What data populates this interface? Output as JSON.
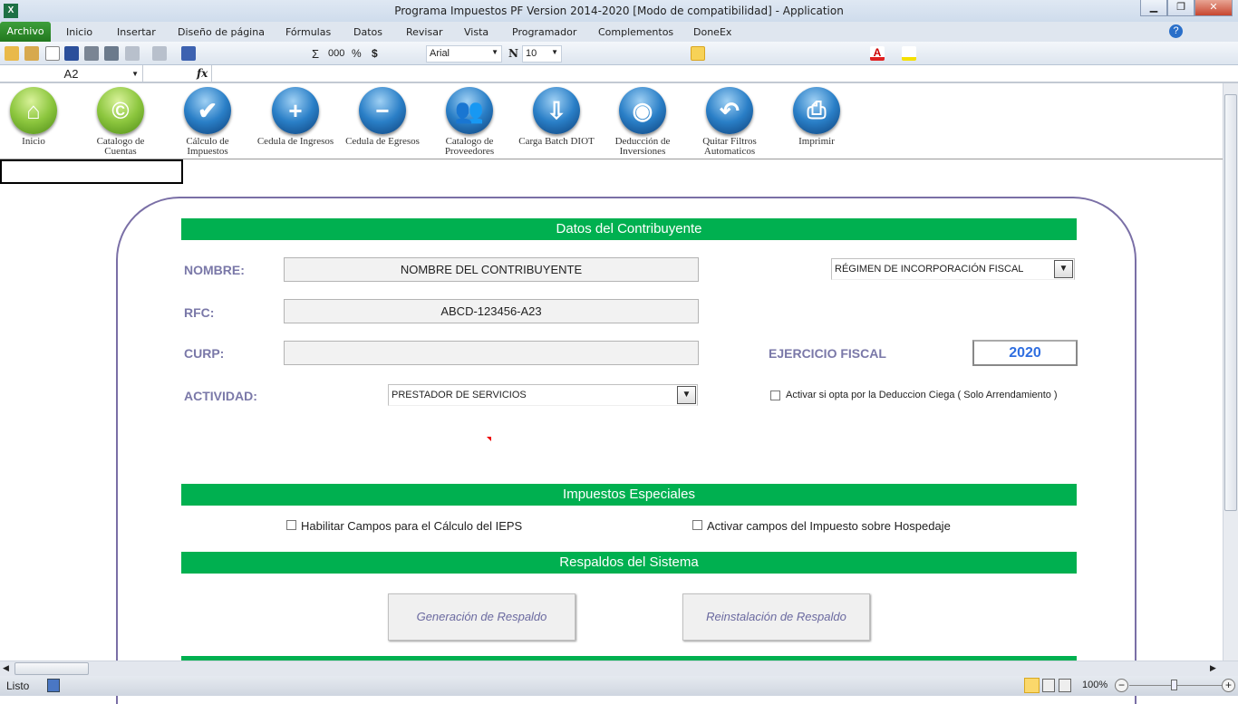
{
  "window": {
    "title": "Programa Impuestos PF Version 2014-2020  [Modo de compatibilidad]  -  Application"
  },
  "ribbon": {
    "tabs": [
      "Archivo",
      "Inicio",
      "Insertar",
      "Diseño de página",
      "Fórmulas",
      "Datos",
      "Revisar",
      "Vista",
      "Programador",
      "Complementos",
      "DoneEx"
    ]
  },
  "toolbar": {
    "font": "Arial",
    "size": "10",
    "sum": "Σ",
    "thousands": "000",
    "percent": "%",
    "currency": "$",
    "bold": "N"
  },
  "formula_bar": {
    "cell": "A2",
    "fx": "fx",
    "value": ""
  },
  "nav_buttons": [
    {
      "label": "Inicio",
      "color": "green",
      "icon": "home-icon",
      "glyph": "⌂"
    },
    {
      "label": "Catalogo de Cuentas",
      "color": "green",
      "icon": "copyright-icon",
      "glyph": "©"
    },
    {
      "label": "Cálculo de Impuestos",
      "color": "blue",
      "icon": "checkmark-icon",
      "glyph": "✔"
    },
    {
      "label": "Cedula de Ingresos",
      "color": "blue",
      "icon": "plus-icon",
      "glyph": "+"
    },
    {
      "label": "Cedula de Egresos",
      "color": "blue",
      "icon": "minus-icon",
      "glyph": "−"
    },
    {
      "label": "Catalogo de Proveedores",
      "color": "blue",
      "icon": "people-icon",
      "glyph": "👥"
    },
    {
      "label": "Carga Batch DIOT",
      "color": "blue",
      "icon": "disk-download-icon",
      "glyph": "⇩"
    },
    {
      "label": "Deducción de Inversiones",
      "color": "blue",
      "icon": "camera-icon",
      "glyph": "◉"
    },
    {
      "label": "Quitar Filtros Automaticos",
      "color": "blue",
      "icon": "undo-icon",
      "glyph": "↶"
    },
    {
      "label": "Imprimir",
      "color": "blue",
      "icon": "printer-icon",
      "glyph": "⎙"
    }
  ],
  "form": {
    "section1": "Datos del Contribuyente",
    "nombre_label": "NOMBRE:",
    "nombre": "NOMBRE DEL CONTRIBUYENTE",
    "rfc_label": "RFC:",
    "rfc": "ABCD-123456-A23",
    "curp_label": "CURP:",
    "curp": "",
    "actividad_label": "ACTIVIDAD:",
    "actividad": "PRESTADOR DE SERVICIOS",
    "regimen": "RÉGIMEN DE INCORPORACIÓN FISCAL",
    "ejercicio_label": "EJERCICIO FISCAL",
    "ejercicio": "2020",
    "deduccion_ciega": "Activar si opta por la Deduccion Ciega ( Solo Arrendamiento )",
    "section2": "Impuestos Especiales",
    "ieps": "Habilitar Campos para el Cálculo del IEPS",
    "hospedaje": "Activar campos del Impuesto sobre Hospedaje",
    "section3": "Respaldos del Sistema",
    "backup_btn": "Generación  de Respaldo",
    "restore_btn": "Reinstalación  de Respaldo"
  },
  "status": {
    "ready": "Listo",
    "zoom": "100%"
  }
}
